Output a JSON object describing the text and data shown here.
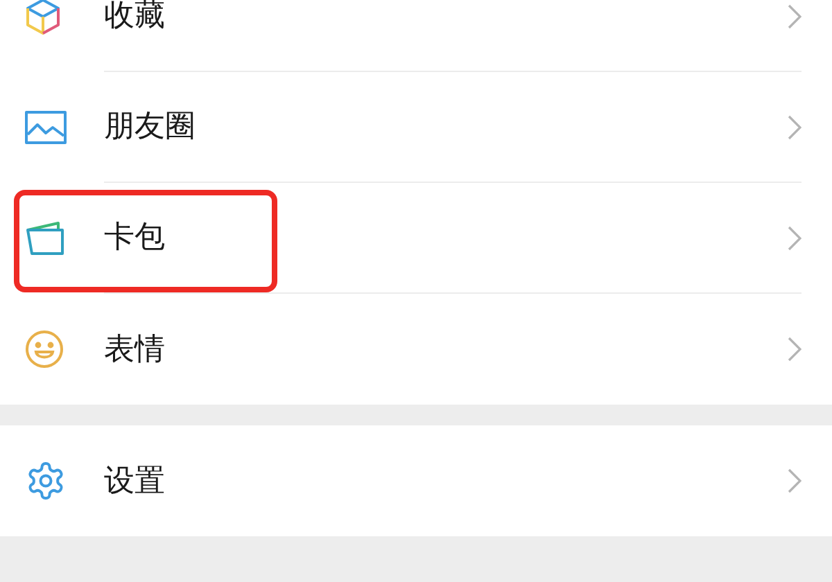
{
  "groups": [
    {
      "items": [
        {
          "kind": "cube",
          "label": "收藏",
          "highlighted": false
        },
        {
          "kind": "picture",
          "label": "朋友圈",
          "highlighted": false
        },
        {
          "kind": "card",
          "label": "卡包",
          "highlighted": true
        },
        {
          "kind": "smiley",
          "label": "表情",
          "highlighted": false
        }
      ]
    },
    {
      "items": [
        {
          "kind": "gear",
          "label": "设置",
          "highlighted": false
        }
      ]
    }
  ]
}
